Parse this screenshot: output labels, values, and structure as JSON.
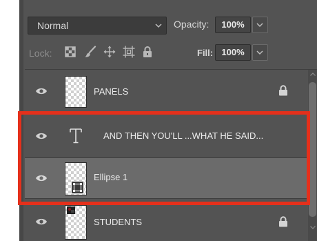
{
  "blend_mode": {
    "value": "Normal"
  },
  "opacity": {
    "label": "Opacity:",
    "value": "100%"
  },
  "lock": {
    "label": "Lock:"
  },
  "fill": {
    "label": "Fill:",
    "value": "100%"
  },
  "layers": [
    {
      "name": "PANELS",
      "type": "pixel",
      "locked": true,
      "visible": true,
      "selected": false
    },
    {
      "name": "AND THEN YOU'LL ...WHAT HE SAID...",
      "type": "text",
      "locked": false,
      "visible": true,
      "selected": false
    },
    {
      "name": "Ellipse 1",
      "type": "shape",
      "locked": false,
      "visible": true,
      "selected": true
    },
    {
      "name": "STUDENTS",
      "type": "pixel",
      "locked": true,
      "visible": true,
      "selected": false
    }
  ],
  "colors": {
    "panel": "#535353",
    "selected_row": "#6b6b6b",
    "highlight": "#e5301b"
  }
}
